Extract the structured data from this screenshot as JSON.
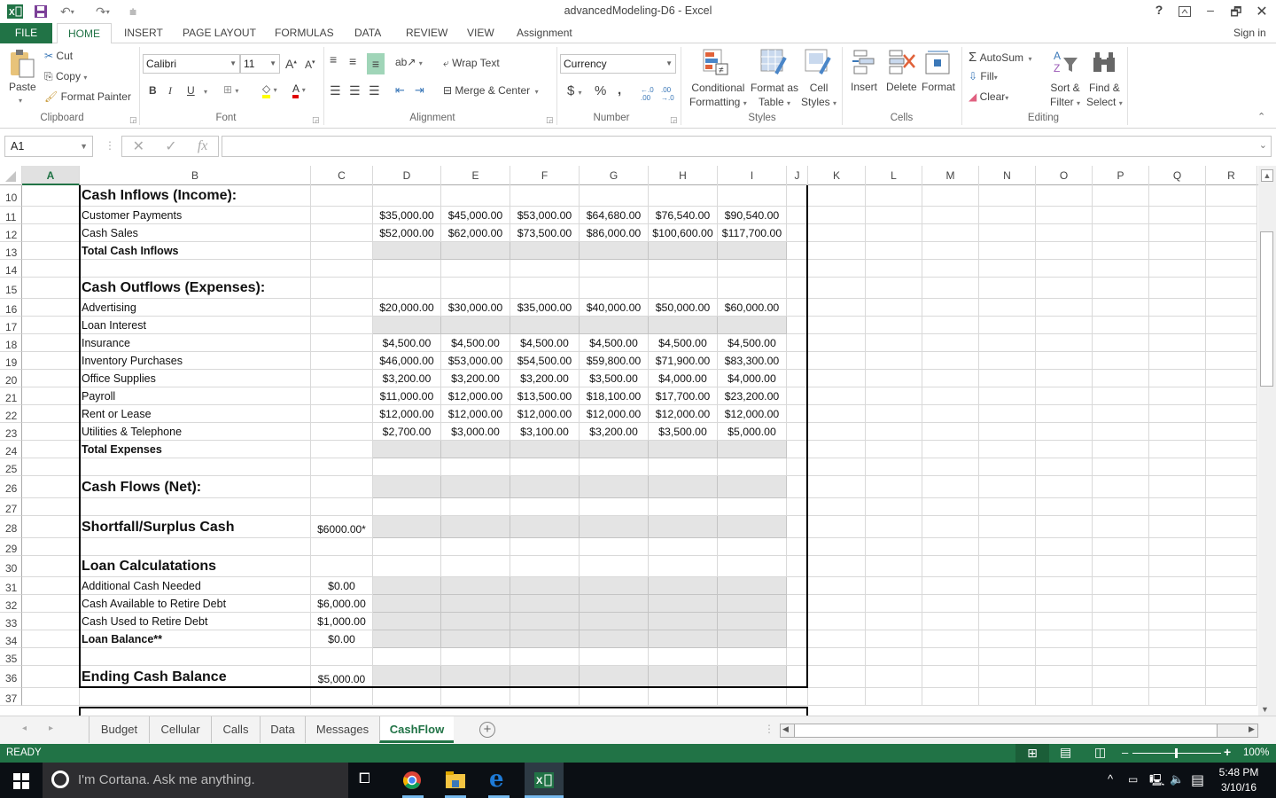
{
  "window": {
    "title": "advancedModeling-D6 - Excel",
    "help_label": "?",
    "sign_in": "Sign in"
  },
  "ribbon_tabs": [
    "FILE",
    "HOME",
    "INSERT",
    "PAGE LAYOUT",
    "FORMULAS",
    "DATA",
    "REVIEW",
    "VIEW",
    "Assignment"
  ],
  "active_ribbon_tab": "HOME",
  "ribbon": {
    "clipboard": {
      "label": "Clipboard",
      "paste": "Paste",
      "cut": "Cut",
      "copy": "Copy",
      "format_painter": "Format Painter"
    },
    "font": {
      "label": "Font",
      "font_name": "Calibri",
      "font_size": "11",
      "bold": "B",
      "italic": "I",
      "underline": "U"
    },
    "alignment": {
      "label": "Alignment",
      "wrap_text": "Wrap Text",
      "merge_center": "Merge & Center"
    },
    "number": {
      "label": "Number",
      "format": "Currency",
      "currency": "$",
      "percent": "%",
      "comma": ",",
      "inc_decimal": "←.0 .00",
      "dec_decimal": ".00 →.0"
    },
    "styles": {
      "label": "Styles",
      "conditional": "Conditional",
      "conditional2": "Formatting",
      "format_as": "Format as",
      "format_as2": "Table",
      "cell": "Cell",
      "cell2": "Styles"
    },
    "cells": {
      "label": "Cells",
      "insert": "Insert",
      "delete": "Delete",
      "format": "Format"
    },
    "editing": {
      "label": "Editing",
      "autosum": "AutoSum",
      "fill": "Fill",
      "clear": "Clear",
      "sort": "Sort &",
      "sort2": "Filter",
      "find": "Find &",
      "find2": "Select"
    }
  },
  "formula_bar": {
    "name_box": "A1",
    "formula": ""
  },
  "columns": [
    "A",
    "B",
    "C",
    "D",
    "E",
    "F",
    "G",
    "H",
    "I",
    "J",
    "K",
    "L",
    "M",
    "N",
    "O",
    "P",
    "Q",
    "R"
  ],
  "selected_column": "A",
  "rows": [
    {
      "num": "10",
      "label": "Cash Inflows (Income):",
      "style": "hdr",
      "c": "",
      "values": [],
      "shade": false
    },
    {
      "num": "11",
      "label": "Customer Payments",
      "style": "",
      "c": "",
      "values": [
        "$35,000.00",
        "$45,000.00",
        "$53,000.00",
        "$64,680.00",
        "$76,540.00",
        "$90,540.00"
      ],
      "shade": false
    },
    {
      "num": "12",
      "label": "Cash Sales",
      "style": "",
      "c": "",
      "values": [
        "$52,000.00",
        "$62,000.00",
        "$73,500.00",
        "$86,000.00",
        "$100,600.00",
        "$117,700.00"
      ],
      "shade": false
    },
    {
      "num": "13",
      "label": "Total Cash Inflows",
      "style": "bold",
      "c": "",
      "values": [],
      "shade": true
    },
    {
      "num": "14",
      "label": "",
      "style": "",
      "c": "",
      "values": [],
      "shade": false
    },
    {
      "num": "15",
      "label": "Cash Outflows (Expenses):",
      "style": "hdr",
      "c": "",
      "values": [],
      "shade": false
    },
    {
      "num": "16",
      "label": "Advertising",
      "style": "",
      "c": "",
      "values": [
        "$20,000.00",
        "$30,000.00",
        "$35,000.00",
        "$40,000.00",
        "$50,000.00",
        "$60,000.00"
      ],
      "shade": false
    },
    {
      "num": "17",
      "label": "Loan Interest",
      "style": "",
      "c": "",
      "values": [],
      "shade": true
    },
    {
      "num": "18",
      "label": "Insurance",
      "style": "",
      "c": "",
      "values": [
        "$4,500.00",
        "$4,500.00",
        "$4,500.00",
        "$4,500.00",
        "$4,500.00",
        "$4,500.00"
      ],
      "shade": false
    },
    {
      "num": "19",
      "label": "Inventory Purchases",
      "style": "",
      "c": "",
      "values": [
        "$46,000.00",
        "$53,000.00",
        "$54,500.00",
        "$59,800.00",
        "$71,900.00",
        "$83,300.00"
      ],
      "shade": false
    },
    {
      "num": "20",
      "label": "Office Supplies",
      "style": "",
      "c": "",
      "values": [
        "$3,200.00",
        "$3,200.00",
        "$3,200.00",
        "$3,500.00",
        "$4,000.00",
        "$4,000.00"
      ],
      "shade": false
    },
    {
      "num": "21",
      "label": "Payroll",
      "style": "",
      "c": "",
      "values": [
        "$11,000.00",
        "$12,000.00",
        "$13,500.00",
        "$18,100.00",
        "$17,700.00",
        "$23,200.00"
      ],
      "shade": false
    },
    {
      "num": "22",
      "label": "Rent or Lease",
      "style": "",
      "c": "",
      "values": [
        "$12,000.00",
        "$12,000.00",
        "$12,000.00",
        "$12,000.00",
        "$12,000.00",
        "$12,000.00"
      ],
      "shade": false
    },
    {
      "num": "23",
      "label": "Utilities & Telephone",
      "style": "",
      "c": "",
      "values": [
        "$2,700.00",
        "$3,000.00",
        "$3,100.00",
        "$3,200.00",
        "$3,500.00",
        "$5,000.00"
      ],
      "shade": false
    },
    {
      "num": "24",
      "label": "Total Expenses",
      "style": "bold",
      "c": "",
      "values": [],
      "shade": true
    },
    {
      "num": "25",
      "label": "",
      "style": "",
      "c": "",
      "values": [],
      "shade": false
    },
    {
      "num": "26",
      "label": "Cash Flows (Net):",
      "style": "hdr",
      "c": "",
      "values": [],
      "shade": true
    },
    {
      "num": "27",
      "label": "",
      "style": "",
      "c": "",
      "values": [],
      "shade": false
    },
    {
      "num": "28",
      "label": "Shortfall/Surplus Cash",
      "style": "hdr",
      "c": "$6000.00*",
      "values": [],
      "shade": true
    },
    {
      "num": "29",
      "label": "",
      "style": "",
      "c": "",
      "values": [],
      "shade": false
    },
    {
      "num": "30",
      "label": "Loan Calculatations",
      "style": "hdr",
      "c": "",
      "values": [],
      "shade": false
    },
    {
      "num": "31",
      "label": "Additional Cash Needed",
      "style": "",
      "c": "$0.00",
      "values": [],
      "shade": true
    },
    {
      "num": "32",
      "label": "Cash Available to Retire Debt",
      "style": "",
      "c": "$6,000.00",
      "values": [],
      "shade": true
    },
    {
      "num": "33",
      "label": "Cash Used to Retire Debt",
      "style": "",
      "c": "$1,000.00",
      "values": [],
      "shade": true
    },
    {
      "num": "34",
      "label": "Loan Balance**",
      "style": "bold",
      "c": "$0.00",
      "values": [],
      "shade": true
    },
    {
      "num": "35",
      "label": "",
      "style": "",
      "c": "",
      "values": [],
      "shade": false
    },
    {
      "num": "36",
      "label": "Ending Cash Balance",
      "style": "hdr",
      "c": "$5,000.00",
      "values": [],
      "shade": true
    },
    {
      "num": "37",
      "label": "",
      "style": "",
      "c": "",
      "values": [],
      "shade": false
    }
  ],
  "sheet_tabs": [
    "Budget",
    "Cellular",
    "Calls",
    "Data",
    "Messages",
    "CashFlow"
  ],
  "active_sheet": "CashFlow",
  "status": {
    "mode": "READY",
    "zoom": "100%",
    "zoom_level_percent": 100
  },
  "taskbar": {
    "search_placeholder": "I'm Cortana. Ask me anything.",
    "time": "5:48 PM",
    "date": "3/10/16"
  },
  "colors": {
    "excel_green": "#217346",
    "shade": "#e4e4e4"
  }
}
